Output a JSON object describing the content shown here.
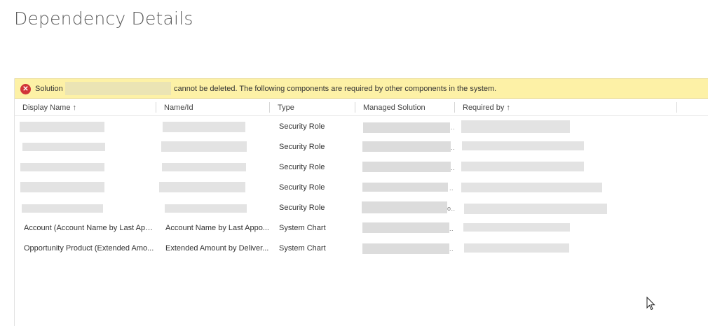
{
  "page": {
    "title": "Dependency Details"
  },
  "banner": {
    "prefix": "Solution",
    "message": "cannot be deleted. The following components are required by other components in the system.",
    "icon": "error-circle-icon"
  },
  "columns": [
    {
      "label": "Display Name",
      "sort": "↑"
    },
    {
      "label": "Name/Id"
    },
    {
      "label": "Type"
    },
    {
      "label": "Managed Solution"
    },
    {
      "label": "Required by",
      "sort": "↑"
    }
  ],
  "rows": [
    {
      "display_name": "",
      "name_id": "",
      "type": "Security Role"
    },
    {
      "display_name": "",
      "name_id": "",
      "type": "Security Role"
    },
    {
      "display_name": "",
      "name_id": "",
      "type": "Security Role"
    },
    {
      "display_name": "",
      "name_id": "",
      "type": "Security Role"
    },
    {
      "display_name": "",
      "name_id": "",
      "type": "Security Role"
    },
    {
      "display_name": "Account (Account Name by Last App...",
      "name_id": "Account Name by Last Appo...",
      "type": "System Chart"
    },
    {
      "display_name": "Opportunity Product (Extended Amo...",
      "name_id": "Extended Amount by Deliver...",
      "type": "System Chart"
    }
  ],
  "colors": {
    "banner_bg": "#fdf1a6",
    "error": "#d13438"
  }
}
